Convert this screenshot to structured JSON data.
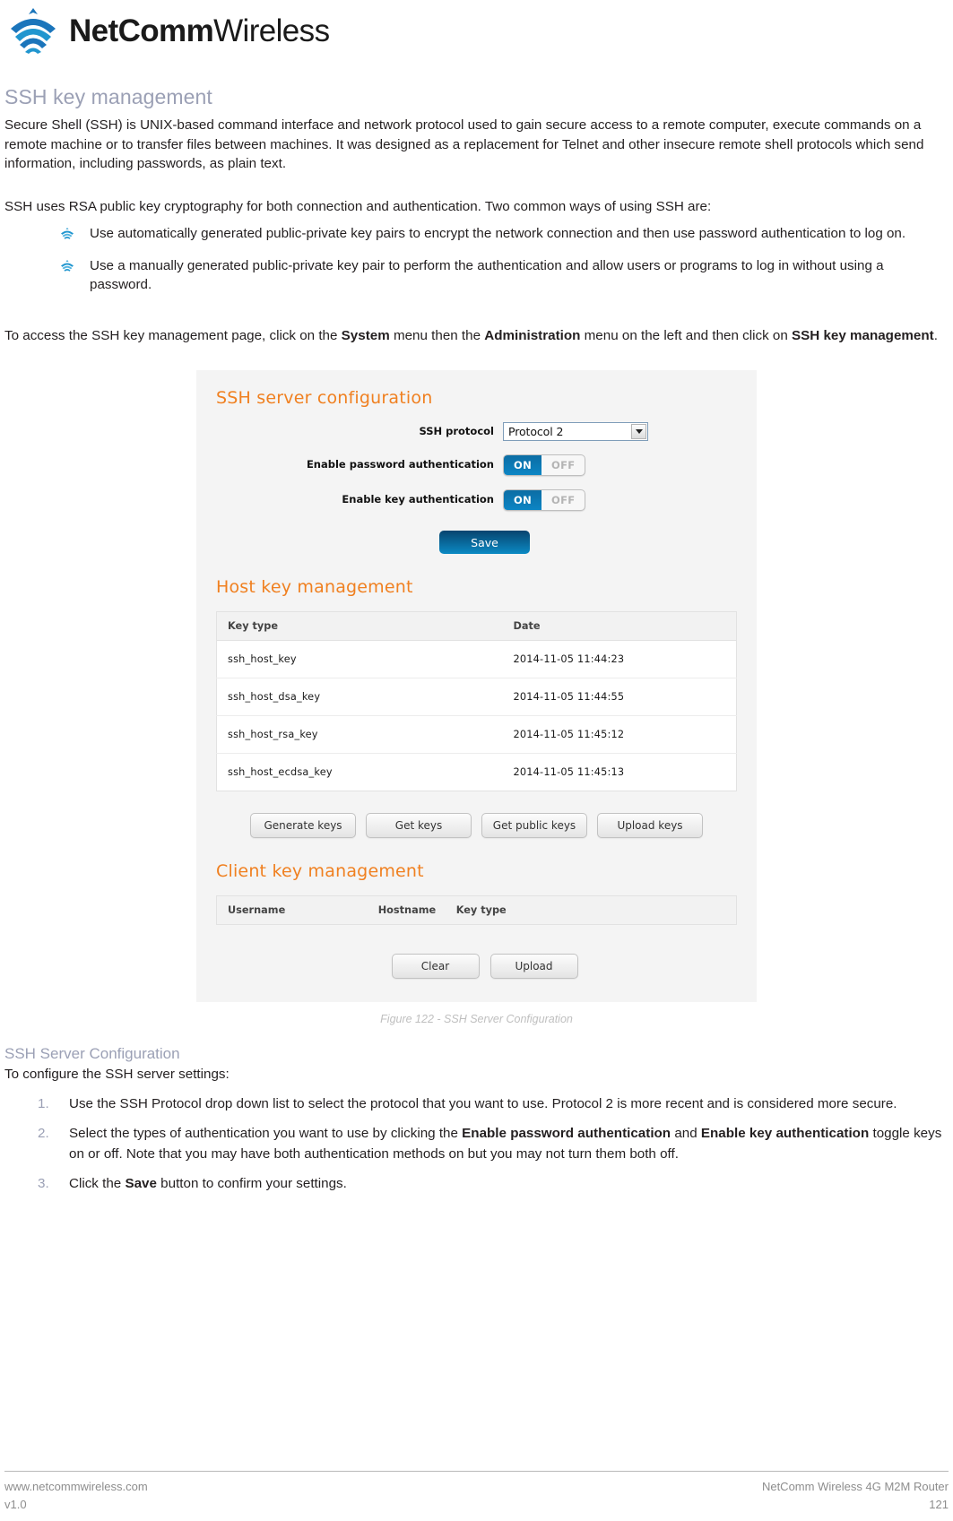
{
  "header": {
    "logo_name": "netcomm-wireless-logo",
    "brand_bold": "NetComm",
    "brand_light": "Wireless"
  },
  "document": {
    "title": "SSH key management",
    "intro_paragraph": "Secure Shell (SSH) is UNIX-based command interface and network protocol used to gain secure access to a remote computer, execute commands on a remote machine or to transfer files between machines. It was designed as a replacement for Telnet and other insecure remote shell protocols which send information, including passwords, as plain text.",
    "rsa_paragraph": "SSH uses RSA public key cryptography for both connection and authentication. Two common ways of using SSH are:",
    "bullets": [
      "Use automatically generated public-private key pairs to encrypt the network connection and then use password authentication to log on.",
      "Use a manually generated public-private key pair to perform the authentication and allow users or programs to log in without using a password."
    ],
    "access_paragraph": {
      "part1": "To access the SSH key management page, click on the ",
      "bold1": "System",
      "part2": " menu then the ",
      "bold2": "Administration",
      "part3": " menu on the left and then click on ",
      "bold3": "SSH key management",
      "part4": "."
    },
    "figure_caption": "Figure 122 - SSH Server Configuration",
    "sub_title": "SSH Server Configuration",
    "sub_intro": "To configure the SSH server settings:",
    "steps": [
      {
        "part1": "Use the SSH Protocol drop down list to select the protocol that you want to use. Protocol 2 is more recent and is considered more secure.",
        "bold1": "",
        "part2": "",
        "bold2": "",
        "part3": ""
      },
      {
        "part1": "Select the types of authentication you want to use by clicking the ",
        "bold1": "Enable password authentication",
        "part2": " and ",
        "bold2": "Enable key authentication",
        "part3": " toggle keys on or off. Note that you may have both authentication methods on but you may not turn them both off."
      },
      {
        "part1": "Click the ",
        "bold1": "Save",
        "part2": " button to confirm your settings.",
        "bold2": "",
        "part3": ""
      }
    ]
  },
  "router_ui": {
    "server_config": {
      "heading": "SSH server configuration",
      "protocol_label": "SSH protocol",
      "protocol_value": "Protocol 2",
      "password_auth_label": "Enable password authentication",
      "password_auth_on": "ON",
      "password_auth_off": "OFF",
      "key_auth_label": "Enable key authentication",
      "key_auth_on": "ON",
      "key_auth_off": "OFF",
      "save_label": "Save"
    },
    "host_key": {
      "heading": "Host key management",
      "columns": [
        "Key type",
        "Date"
      ],
      "rows": [
        [
          "ssh_host_key",
          "2014-11-05 11:44:23"
        ],
        [
          "ssh_host_dsa_key",
          "2014-11-05 11:44:55"
        ],
        [
          "ssh_host_rsa_key",
          "2014-11-05 11:45:12"
        ],
        [
          "ssh_host_ecdsa_key",
          "2014-11-05 11:45:13"
        ]
      ],
      "buttons": [
        "Generate keys",
        "Get keys",
        "Get public keys",
        "Upload keys"
      ]
    },
    "client_key": {
      "heading": "Client key management",
      "columns": [
        "Username",
        "Hostname",
        "Key type"
      ],
      "rows": [],
      "buttons": [
        "Clear",
        "Upload"
      ]
    },
    "colors": {
      "heading_orange": "#f08020",
      "toggle_blue": "#0c85c4",
      "save_blue": "#07446f"
    }
  },
  "footer": {
    "website": "www.netcommwireless.com",
    "product": "NetComm Wireless 4G M2M Router",
    "version": "v1.0",
    "page_number": "121"
  }
}
